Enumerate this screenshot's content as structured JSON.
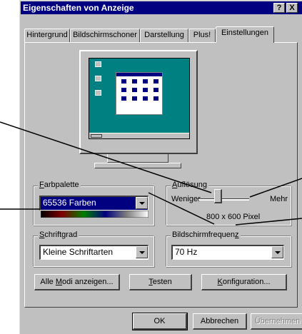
{
  "window": {
    "title": "Eigenschaften von Anzeige",
    "help_glyph": "?",
    "close_glyph": "X"
  },
  "tabs": [
    {
      "label": "Hintergrund"
    },
    {
      "label": "Bildschirmschoner"
    },
    {
      "label": "Darstellung"
    },
    {
      "label": "Plus!"
    },
    {
      "label": "Einstellungen",
      "active": true
    }
  ],
  "farbpalette": {
    "label_first": "F",
    "label_rest": "arbpalette",
    "value": "65536 Farben"
  },
  "aufloesung": {
    "label_first": "A",
    "label_rest": "uflösung",
    "min_label": "Weniger",
    "max_label": "Mehr",
    "value": "800 x 600 Pixel",
    "level": 0.33
  },
  "schriftgrad": {
    "label_first": "S",
    "label_rest": "chriftgrad",
    "value": "Kleine Schriftarten"
  },
  "frequenz": {
    "label_pre": "Bildschirmfrequen",
    "label_u": "z",
    "value": "70 Hz"
  },
  "buttons": {
    "modi_pre": "Alle ",
    "modi_u": "M",
    "modi_post": "odi anzeigen...",
    "testen_u": "T",
    "testen_post": "esten",
    "konfig_u": "K",
    "konfig_post": "onfiguration..."
  },
  "footer": {
    "ok": "OK",
    "cancel": "Abbrechen",
    "apply": "Übernehmen"
  },
  "colors": {
    "titlebar": "#000080",
    "face": "#c0c0c0",
    "desktop": "#008080",
    "selection": "#000080"
  },
  "icons": [
    "help-icon",
    "close-icon",
    "dropdown-arrow-icon"
  ]
}
